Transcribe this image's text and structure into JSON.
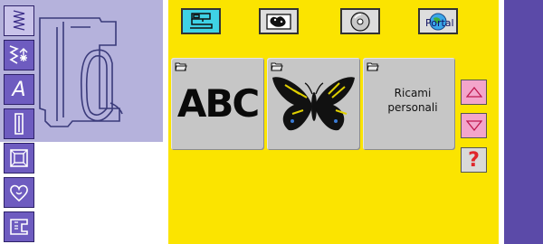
{
  "toolbar": {
    "buttons": [
      {
        "name": "embroidery-machine",
        "active": true
      },
      {
        "name": "hoop-selection",
        "active": false
      },
      {
        "name": "cd-rom",
        "active": false
      },
      {
        "name": "portal",
        "label": "Portal",
        "active": false
      }
    ]
  },
  "tiles": [
    {
      "name": "alphabets",
      "text": "ABC"
    },
    {
      "name": "embroidery-motifs"
    },
    {
      "name": "personal-designs",
      "label_line1": "Ricami",
      "label_line2": "personali"
    }
  ],
  "side_controls": [
    "scroll-up",
    "scroll-down",
    "help"
  ],
  "help_symbol": "?",
  "sidebar": {
    "items": [
      "stitch-menu",
      "embroidery-menu",
      "alphabet-menu",
      "buttonhole-menu",
      "quilt-menu",
      "favorites-menu",
      "machine-mode"
    ],
    "alphabet_glyph": "A"
  },
  "colors": {
    "background": "#fbe400",
    "sidebar": "#5b4aa8",
    "preview": "#b5b2dc",
    "active_button": "#3fd2e5",
    "scroll_buttons": "#f3a5cb",
    "help": "#e0262c"
  }
}
